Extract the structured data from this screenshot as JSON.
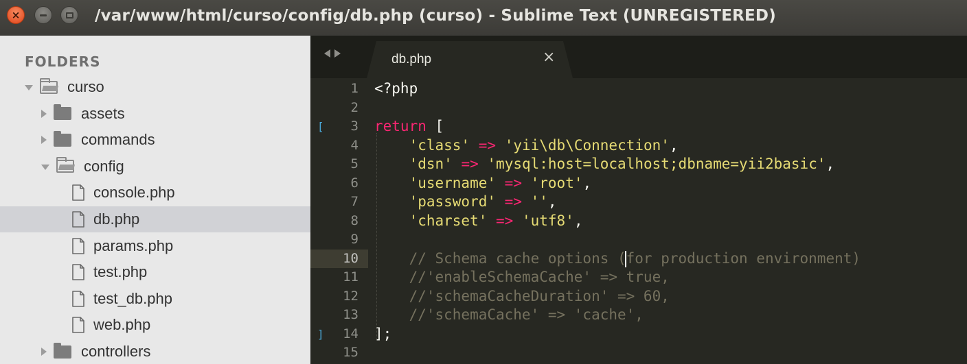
{
  "window": {
    "title": "/var/www/html/curso/config/db.php (curso) - Sublime Text (UNREGISTERED)"
  },
  "sidebar": {
    "header": "FOLDERS",
    "tree": [
      {
        "label": "curso",
        "type": "folder",
        "state": "expanded"
      },
      {
        "label": "assets",
        "type": "folder",
        "state": "collapsed"
      },
      {
        "label": "commands",
        "type": "folder",
        "state": "collapsed"
      },
      {
        "label": "config",
        "type": "folder",
        "state": "expanded"
      },
      {
        "label": "console.php",
        "type": "file"
      },
      {
        "label": "db.php",
        "type": "file",
        "selected": true
      },
      {
        "label": "params.php",
        "type": "file"
      },
      {
        "label": "test.php",
        "type": "file"
      },
      {
        "label": "test_db.php",
        "type": "file"
      },
      {
        "label": "web.php",
        "type": "file"
      },
      {
        "label": "controllers",
        "type": "folder",
        "state": "collapsed"
      }
    ]
  },
  "editor": {
    "tab": {
      "title": "db.php",
      "close_symbol": "×"
    },
    "current_line": 10,
    "lines": [
      {
        "num": "1",
        "tokens": [
          {
            "t": "<?php",
            "c": "plain"
          }
        ]
      },
      {
        "num": "2",
        "tokens": []
      },
      {
        "num": "3",
        "marker": "[",
        "tokens": [
          {
            "t": "return ",
            "c": "kw"
          },
          {
            "t": "[",
            "c": "plain"
          }
        ]
      },
      {
        "num": "4",
        "tokens": [
          {
            "t": "    ",
            "c": "plain"
          },
          {
            "t": "'class'",
            "c": "str"
          },
          {
            "t": " ",
            "c": "plain"
          },
          {
            "t": "=>",
            "c": "op"
          },
          {
            "t": " ",
            "c": "plain"
          },
          {
            "t": "'yii\\db\\Connection'",
            "c": "str"
          },
          {
            "t": ",",
            "c": "plain"
          }
        ]
      },
      {
        "num": "5",
        "tokens": [
          {
            "t": "    ",
            "c": "plain"
          },
          {
            "t": "'dsn'",
            "c": "str"
          },
          {
            "t": " ",
            "c": "plain"
          },
          {
            "t": "=>",
            "c": "op"
          },
          {
            "t": " ",
            "c": "plain"
          },
          {
            "t": "'mysql:host=localhost;dbname=yii2basic'",
            "c": "str"
          },
          {
            "t": ",",
            "c": "plain"
          }
        ]
      },
      {
        "num": "6",
        "tokens": [
          {
            "t": "    ",
            "c": "plain"
          },
          {
            "t": "'username'",
            "c": "str"
          },
          {
            "t": " ",
            "c": "plain"
          },
          {
            "t": "=>",
            "c": "op"
          },
          {
            "t": " ",
            "c": "plain"
          },
          {
            "t": "'root'",
            "c": "str"
          },
          {
            "t": ",",
            "c": "plain"
          }
        ]
      },
      {
        "num": "7",
        "tokens": [
          {
            "t": "    ",
            "c": "plain"
          },
          {
            "t": "'password'",
            "c": "str"
          },
          {
            "t": " ",
            "c": "plain"
          },
          {
            "t": "=>",
            "c": "op"
          },
          {
            "t": " ",
            "c": "plain"
          },
          {
            "t": "''",
            "c": "str"
          },
          {
            "t": ",",
            "c": "plain"
          }
        ]
      },
      {
        "num": "8",
        "tokens": [
          {
            "t": "    ",
            "c": "plain"
          },
          {
            "t": "'charset'",
            "c": "str"
          },
          {
            "t": " ",
            "c": "plain"
          },
          {
            "t": "=>",
            "c": "op"
          },
          {
            "t": " ",
            "c": "plain"
          },
          {
            "t": "'utf8'",
            "c": "str"
          },
          {
            "t": ",",
            "c": "plain"
          }
        ]
      },
      {
        "num": "9",
        "tokens": []
      },
      {
        "num": "10",
        "tokens": [
          {
            "t": "    // Schema cache options (for production environment)",
            "c": "cmt"
          }
        ]
      },
      {
        "num": "11",
        "tokens": [
          {
            "t": "    //'enableSchemaCache' => true,",
            "c": "cmt"
          }
        ]
      },
      {
        "num": "12",
        "tokens": [
          {
            "t": "    //'schemaCacheDuration' => 60,",
            "c": "cmt"
          }
        ]
      },
      {
        "num": "13",
        "tokens": [
          {
            "t": "    //'schemaCache' => 'cache',",
            "c": "cmt"
          }
        ]
      },
      {
        "num": "14",
        "marker": "]",
        "tokens": [
          {
            "t": "];",
            "c": "plain"
          }
        ]
      },
      {
        "num": "15",
        "tokens": []
      }
    ]
  },
  "colors": {
    "keyword": "#f92672",
    "string": "#e6db74",
    "comment": "#75715e",
    "background": "#272822",
    "sidebar": "#e8e8e8"
  }
}
